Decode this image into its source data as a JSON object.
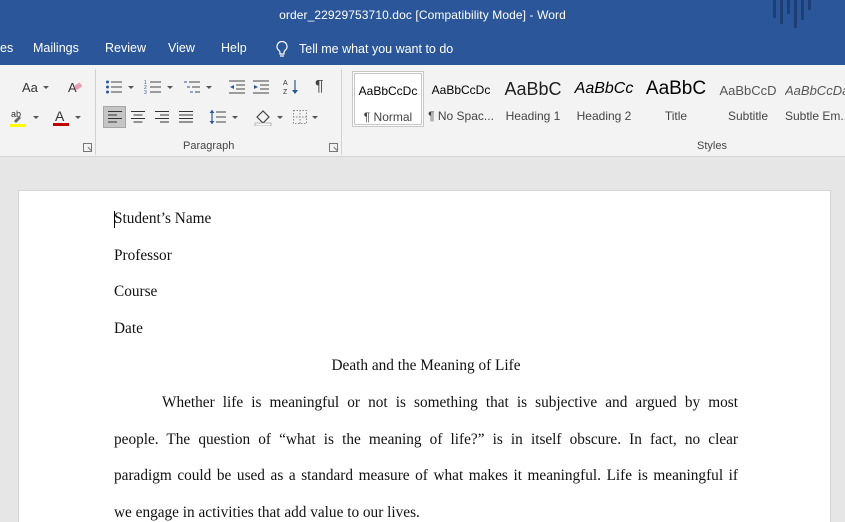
{
  "window": {
    "title": "order_22929753710.doc [Compatibility Mode]  -  Word"
  },
  "tabs": [
    {
      "label": "es"
    },
    {
      "label": "Mailings"
    },
    {
      "label": "Review"
    },
    {
      "label": "View"
    },
    {
      "label": "Help"
    }
  ],
  "tell_me": {
    "label": "Tell me what you want to do",
    "icon": "lightbulb-icon"
  },
  "ribbon": {
    "font_group": {
      "change_case_label": "Aa"
    },
    "paragraph_group": {
      "label": "Paragraph"
    },
    "styles_group": {
      "label": "Styles"
    },
    "styles": [
      {
        "sample": "AaBbCcDc",
        "name": "¶ Normal"
      },
      {
        "sample": "AaBbCcDc",
        "name": "¶ No Spac..."
      },
      {
        "sample": "AaBbC",
        "name": "Heading 1"
      },
      {
        "sample": "AaBbCc",
        "name": "Heading 2"
      },
      {
        "sample": "AaBbC",
        "name": "Title"
      },
      {
        "sample": "AaBbCcD",
        "name": "Subtitle"
      },
      {
        "sample": "AaBbCcDa",
        "name": "Subtle Em..."
      }
    ],
    "colors": {
      "font_color": "#c00000",
      "highlight": "#ffff00"
    }
  },
  "document": {
    "header_lines": [
      "Student’s Name",
      "Professor",
      "Course",
      "Date"
    ],
    "title": "Death and the Meaning of Life",
    "body_lines": [
      "Whether life is meaningful or not is something that is subjective and argued by most",
      "people. The question of “what is the meaning of life?” is in itself obscure. In fact, no clear",
      "paradigm could be used as a standard measure of what makes it meaningful. Life is meaningful if",
      "we engage in activities that add value to our lives."
    ]
  }
}
